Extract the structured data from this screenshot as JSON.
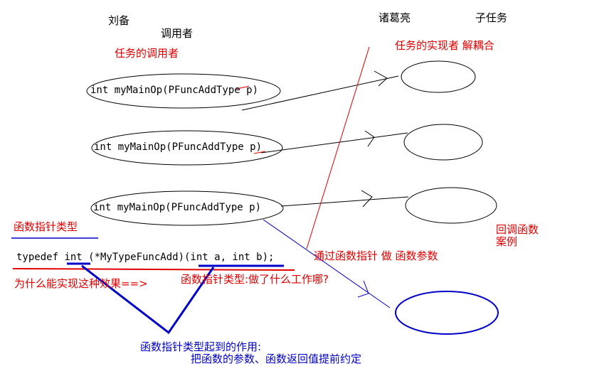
{
  "labels": {
    "caller_name": "刘备",
    "caller_role": "调用者",
    "caller_task": "任务的调用者",
    "impl_name": "诸葛亮",
    "impl_role": "子任务",
    "impl_task": "任务的实现者 解耦合",
    "func_ptr_type": "函数指针类型",
    "callback_case_line1": "回调函数",
    "callback_case_line2": "案例",
    "via_func_ptr": "通过函数指针 做 函数参数",
    "why_effect": "为什么能实现这种效果==>",
    "what_work": "函数指针类型:做了什么工作哪?",
    "role_of_type_line1": "函数指针类型起到的作用:",
    "role_of_type_line2": "把函数的参数、函数返回值提前约定"
  },
  "code": {
    "call_1": "int myMainOp(PFuncAddType p)",
    "call_2": "int myMainOp(PFuncAddType p)",
    "call_3": "int myMainOp(PFuncAddType p)",
    "typedef_line": "typedef int (*MyTypeFuncAdd)(int a, int b);"
  },
  "colors": {
    "red": "#e00000",
    "blue": "#0000c8",
    "black": "#000000"
  }
}
